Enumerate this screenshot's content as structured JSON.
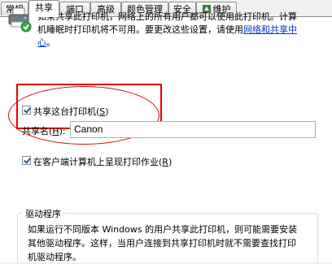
{
  "tabs": [
    {
      "label": "常规"
    },
    {
      "label": "共享"
    },
    {
      "label": "端口"
    },
    {
      "label": "高级"
    },
    {
      "label": "颜色管理"
    },
    {
      "label": "安全"
    },
    {
      "label": "维护"
    }
  ],
  "active_tab": "共享",
  "description": {
    "text": "如果共享此打印机，网络上的所有用户都可以使用此打印机。计算机睡眠时打印机将不可用。要更改这些设置，请使用",
    "link": "网络和共享中心",
    "end": "。"
  },
  "share_printer": {
    "label": "共享这台打印机(",
    "key": "S",
    "suffix": ")",
    "checked": true
  },
  "share_name": {
    "label": "共享名(",
    "key": "H",
    "suffix": "):",
    "value": "Canon"
  },
  "render_jobs": {
    "label": "在客户端计算机上呈现打印作业(",
    "key": "R",
    "suffix": ")",
    "checked": true
  },
  "drivers": {
    "title": "驱动程序",
    "text": "如果运行不同版本 Windows 的用户共享此打印机，则可能需要安装其他驱动程序。这样，当用户连接到共享打印机时就不需要查找打印机驱动程序。"
  },
  "colors": {
    "highlight_red": "#e10000",
    "link_blue": "#0033cc"
  },
  "icons": [
    "printer-icon",
    "maintenance-icon"
  ]
}
